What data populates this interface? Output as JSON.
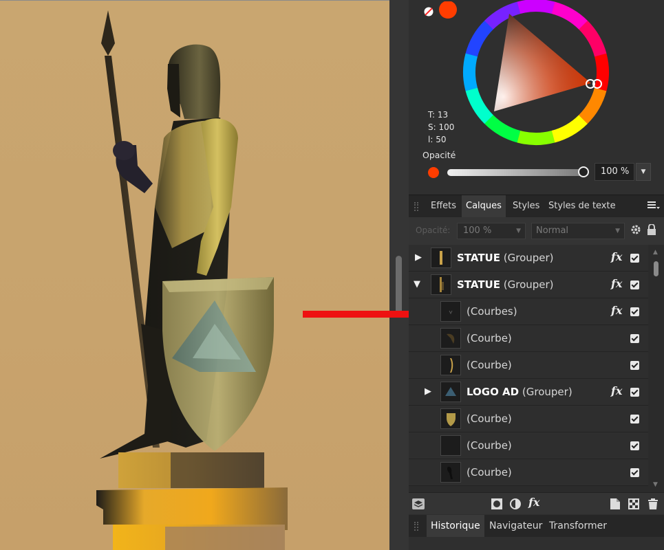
{
  "colors": {
    "accent": "#ff3d00",
    "canvas_background": "#c9a670",
    "panel_background": "#2f2f2f",
    "annotation_arrow": "#ee1111"
  },
  "color_panel": {
    "t_label": "T: 13",
    "s_label": "S: 100",
    "l_label": "l: 50",
    "opacity_label": "Opacité",
    "opacity_value": "100 %",
    "opacity_fraction": 1.0
  },
  "tabs": [
    {
      "label": "Effets",
      "active": false
    },
    {
      "label": "Calques",
      "active": true
    },
    {
      "label": "Styles",
      "active": false
    },
    {
      "label": "Styles de texte",
      "active": false
    }
  ],
  "layer_toolbar": {
    "opacity_label": "Opacité:",
    "opacity_value": "100 %",
    "blend_mode": "Normal"
  },
  "layers": [
    {
      "name": "STATUE",
      "type": "(Grouper)",
      "expander": "collapsed",
      "fx": true,
      "visible": true
    },
    {
      "name": "STATUE",
      "type": "(Grouper)",
      "expander": "expanded",
      "fx": true,
      "visible": true
    },
    {
      "name": "",
      "type": "(Courbes)",
      "expander": "none",
      "fx": true,
      "visible": true
    },
    {
      "name": "",
      "type": "(Courbe)",
      "expander": "none",
      "fx": false,
      "visible": true
    },
    {
      "name": "",
      "type": "(Courbe)",
      "expander": "none",
      "fx": false,
      "visible": true
    },
    {
      "name": "LOGO AD",
      "type": "(Grouper)",
      "expander": "collapsed",
      "fx": true,
      "visible": true
    },
    {
      "name": "",
      "type": "(Courbe)",
      "expander": "none",
      "fx": false,
      "visible": true
    },
    {
      "name": "",
      "type": "(Courbe)",
      "expander": "none",
      "fx": false,
      "visible": true
    },
    {
      "name": "",
      "type": "(Courbe)",
      "expander": "none",
      "fx": false,
      "visible": true
    }
  ],
  "fx_label": "fx",
  "bottom_tabs": [
    {
      "label": "Historique",
      "active": true
    },
    {
      "label": "Navigateur",
      "active": false
    },
    {
      "label": "Transformer",
      "active": false
    }
  ],
  "icons": {
    "menu": "hamburger-menu-icon",
    "gear": "gear-icon",
    "lock": "lock-icon",
    "layers_stack": "layers-stack-icon",
    "mask": "mask-icon",
    "adjustment": "adjustment-icon",
    "new_layer": "new-layer-icon",
    "new_pixel_layer": "new-pixel-layer-icon",
    "delete": "trash-icon"
  }
}
